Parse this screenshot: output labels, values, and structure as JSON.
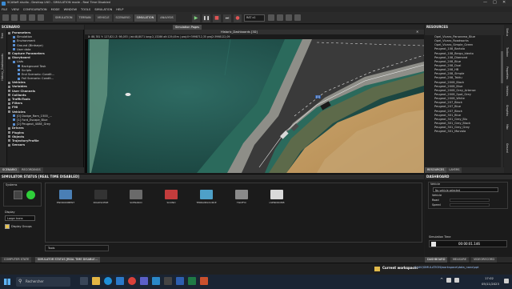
{
  "window": {
    "title": "SCANeR studio - Desktop LNO - SIMULATION mode - Real Time Disabled",
    "controls": [
      "—",
      "□",
      "✕"
    ]
  },
  "menu": [
    "FILE",
    "VIEW",
    "CONFIGURATION",
    "MODE",
    "WINDOW",
    "TOOLS",
    "SIMULATION",
    "HELP"
  ],
  "toolbar": {
    "mode_tabs": [
      "SIMULATION",
      "TERRAIN",
      "VEHICLE",
      "SCENARIO",
      "SIMULATION",
      "ANALYSIS"
    ],
    "speed_value": "RAT x1"
  },
  "scenario_panel": {
    "title": "SCENARIO",
    "side_tabs": [
      "Tree",
      "History_Dashboards"
    ],
    "tree": [
      {
        "label": "Parameters",
        "level": 0,
        "bold": true
      },
      {
        "label": "Simulation",
        "level": 1
      },
      {
        "label": "Environment",
        "level": 1
      },
      {
        "label": "Ground (Birdseye)",
        "level": 1
      },
      {
        "label": "User data",
        "level": 1
      },
      {
        "label": "Capture Parameters",
        "level": 0,
        "bold": true
      },
      {
        "label": "Storyboard",
        "level": 0,
        "bold": true
      },
      {
        "label": "Lists",
        "level": 1
      },
      {
        "label": "Background Task",
        "level": 2
      },
      {
        "label": "Scripts",
        "level": 2
      },
      {
        "label": "End Scenario: Condit...",
        "level": 2
      },
      {
        "label": "Fail Scenario: Condit...",
        "level": 2
      },
      {
        "label": "Vehicles",
        "level": 0,
        "bold": true
      },
      {
        "label": "Variables",
        "level": 0,
        "bold": true
      },
      {
        "label": "User Channels",
        "level": 0,
        "bold": true
      },
      {
        "label": "Colliants",
        "level": 0,
        "bold": true
      },
      {
        "label": "TrafficTools",
        "level": 0,
        "bold": true
      },
      {
        "label": "Filters",
        "level": 0,
        "bold": true
      },
      {
        "label": "FMI",
        "level": 0,
        "bold": true
      },
      {
        "label": "Vehicles",
        "level": 0,
        "bold": true
      },
      {
        "label": "[0] Dodge_Ram_1500_...",
        "level": 1
      },
      {
        "label": "[1] Ford_Escape_Blue",
        "level": 1
      },
      {
        "label": "[2] Peugeot_408E_Grey",
        "level": 1
      },
      {
        "label": "Drivers",
        "level": 0,
        "bold": true
      },
      {
        "label": "Plugins",
        "level": 0,
        "bold": true
      },
      {
        "label": "Objects",
        "level": 0,
        "bold": true
      },
      {
        "label": "TrajectoryProfile",
        "level": 0,
        "bold": true
      },
      {
        "label": "Sensors",
        "level": 0,
        "bold": true
      }
    ],
    "bottom_tabs": [
      "SCENARIO",
      "RECORDINGS"
    ]
  },
  "viewport": {
    "tab_label": "Simulation Pages",
    "title": "Historic_Dashboards [3D]",
    "status_line": "X: 88,781 Y: 127,821 Z: 98,053 | lat:48,8071 long:2,13286 alt:129,45m | proj:0+3998712,35 proj2:3998122,09",
    "vehicle_label": "[0]"
  },
  "resources": {
    "title": "RESOURCES",
    "items": [
      "Opel_Vivaro_Panorama_Blue",
      "Opel_Vivaro_Roadworks",
      "Opel_Vivaro_Simple_Green",
      "Peugeot_108_Bartolo",
      "Peugeot_108_Bergo_Idento",
      "Peugeot_108_Diamond",
      "Peugeot_208_Blue",
      "Peugeot_208_Dual",
      "Peugeot_208_HB",
      "Peugeot_208_Simple",
      "Peugeot_208_Taktu",
      "Peugeot_2008_Black",
      "Peugeot_2008_Blue",
      "Peugeot_2008_Grey_Artense",
      "Peugeot_2008_Spot_Grey",
      "Peugeot_2008_White",
      "Peugeot_207_Black",
      "Peugeot_207_Blue",
      "Peugeot_207_Black",
      "Peugeot_301_Blue",
      "Peugeot_301_Grey_Blu",
      "Peugeot_301_Grey_Black",
      "Peugeot_301_Grey_Grey",
      "Peugeot_301_Morzala"
    ],
    "bottom_tabs": [
      "RESOURCES",
      "LAYERS"
    ],
    "side_tabs": [
      "Status",
      "Toolbox",
      "Properties",
      "Vehicles",
      "Graphics",
      "Misc",
      "Ground"
    ]
  },
  "dashboard": {
    "title": "DASHBOARD",
    "vehicle_group": "Vehicle",
    "vehicle_select": "No vehicle selected",
    "rows": [
      "Vehicle",
      "Road",
      "Speed"
    ],
    "sim_time_label": "Simulation Time",
    "sim_time_value": "00:00:01.146",
    "bottom_tabs": [
      "DASHBOARD",
      "MEASURE",
      "VIDEORECORD"
    ]
  },
  "simulator_status": {
    "title": "SIMULATOR STATUS [REAL TIME DISABLED]",
    "controls_label": "Systems",
    "display_label": "Display",
    "display_value": "Large Icons",
    "display_groups": "Display Groups",
    "modules": [
      {
        "label": "ENVIRONMENT",
        "color": "#4a7fb5"
      },
      {
        "label": "ROADSCENE",
        "color": "#333333"
      },
      {
        "label": "SCENARIO",
        "color": "#6a6a6a"
      },
      {
        "label": "SOUND",
        "color": "#c33c3c"
      },
      {
        "label": "TERRAINSOURCE",
        "color": "#4ea0c8"
      },
      {
        "label": "TRAFFIC",
        "color": "#8a8a8a"
      },
      {
        "label": "LSENDROMB",
        "color": "#d9d9d9"
      }
    ],
    "tools_label": "Tools"
  },
  "bottom_tabs": [
    "COMPUTER STATE",
    "SIMULATOR STATUS [REAL TIME DISABLE..."
  ],
  "workspace": {
    "label": "Current workspace:",
    "path": "C:\\AV\\SIMULATION\\workspace\\data_nano\\opt"
  },
  "taskbar": {
    "search_placeholder": "Rechercher",
    "time": "17:02",
    "date": "05/11/2023"
  }
}
